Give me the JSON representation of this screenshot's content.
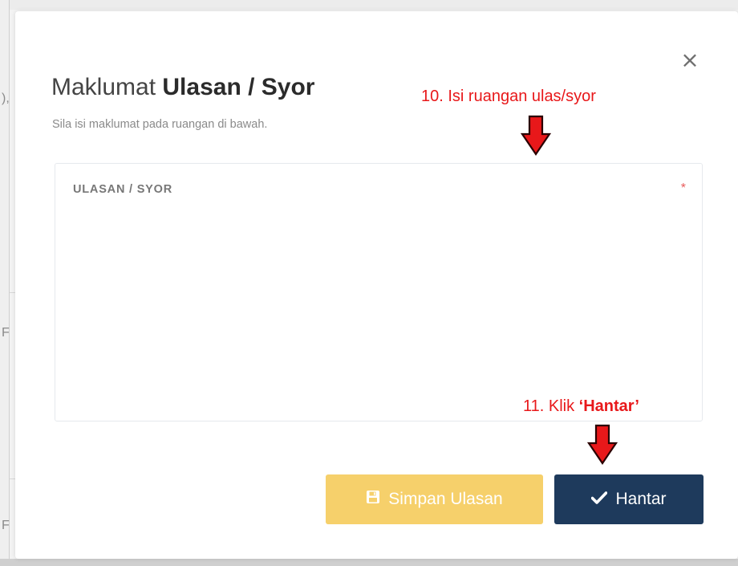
{
  "background": {
    "left_edge_glyphs": [
      "),",
      "F",
      "F"
    ]
  },
  "modal": {
    "title_prefix": "Maklumat",
    "title_emphasis": "Ulasan / Syor",
    "subtitle": "Sila isi maklumat pada ruangan di bawah.",
    "close_icon": "×",
    "field": {
      "label": "ULASAN / SYOR",
      "required_marker": "*",
      "value": ""
    },
    "buttons": {
      "save_label": "Simpan Ulasan",
      "save_icon": "save-icon",
      "submit_label": "Hantar",
      "submit_icon": "check-icon"
    }
  },
  "annotations": {
    "step10": "10. Isi ruangan ulas/syor",
    "step11_prefix": "11. Klik ",
    "step11_emphasis": "‘Hantar’"
  },
  "colors": {
    "save_button": "#f6d06b",
    "submit_button": "#1e3a5c",
    "annotation": "#e8181a",
    "required": "#e85a5a"
  }
}
